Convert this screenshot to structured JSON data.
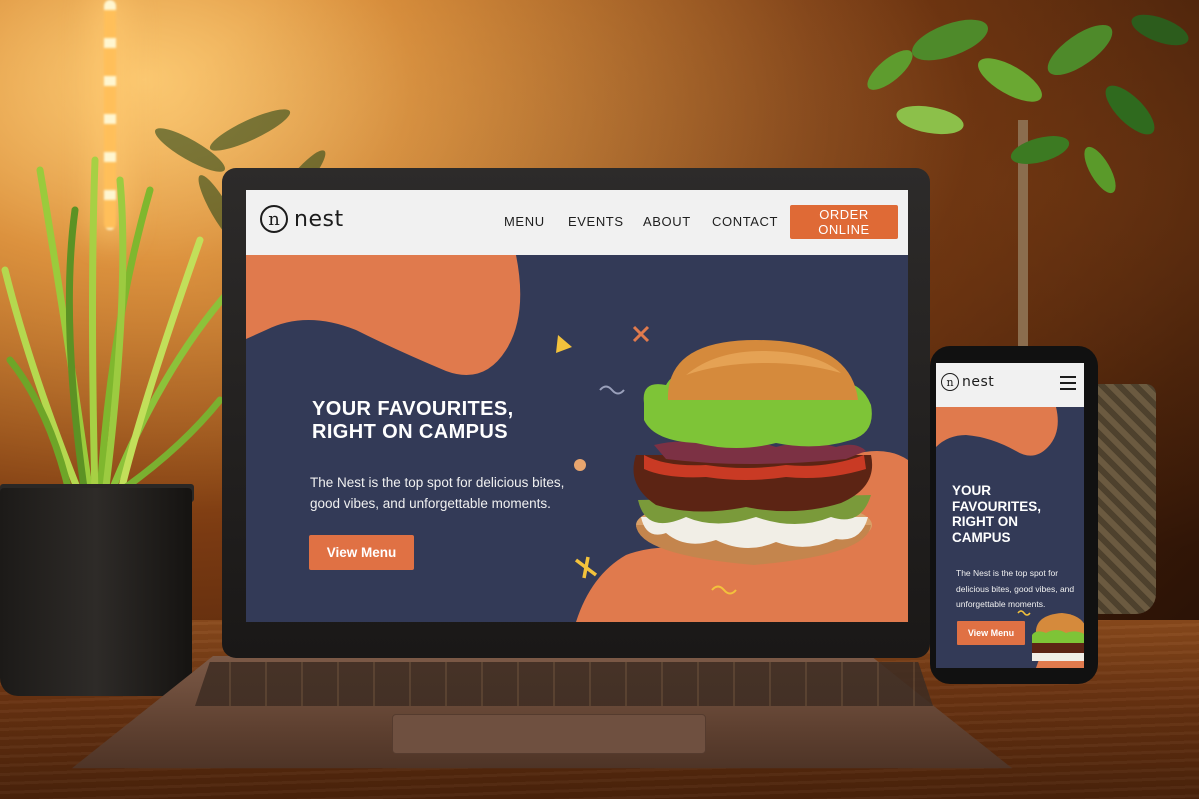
{
  "site": {
    "logo_text": "nest",
    "logo_glyph": "n",
    "nav": {
      "menu": "MENU",
      "events": "EVENTS",
      "about": "ABOUT",
      "contact": "CONTACT",
      "order_button": "ORDER ONLINE"
    },
    "hero": {
      "headline_line1": "YOUR FAVOURITES,",
      "headline_line2": "RIGHT ON CAMPUS",
      "subtext_line1": "The Nest is the top spot for delicious bites,",
      "subtext_line2": "good vibes, and unforgettable moments.",
      "cta": "View Menu"
    }
  },
  "mobile": {
    "logo_text": "nest",
    "logo_glyph": "n",
    "menu_icon": "hamburger-icon",
    "hero": {
      "headline_line1": "YOUR",
      "headline_line2": "FAVOURITES,",
      "headline_line3": "RIGHT ON",
      "headline_line4": "CAMPUS",
      "subtext_line1": "The Nest is the top spot for",
      "subtext_line2": "delicious bites, good vibes, and",
      "subtext_line3": "unforgettable moments.",
      "cta": "View Menu"
    }
  },
  "colors": {
    "brand_orange": "#df6a36",
    "hero_navy": "#333a57",
    "nav_bg": "#f1f1f1",
    "accent_yellow": "#f3c23c"
  }
}
